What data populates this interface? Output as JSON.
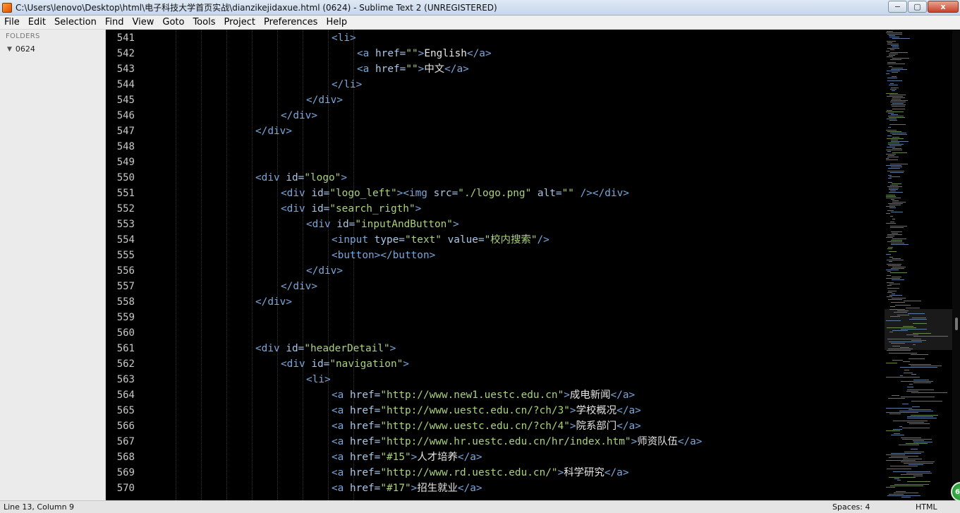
{
  "window": {
    "title": "C:\\Users\\lenovo\\Desktop\\html\\电子科技大学首页实战\\dianzikejidaxue.html (0624) - Sublime Text 2 (UNREGISTERED)",
    "minimize": "−",
    "maximize": "▢",
    "close": "x"
  },
  "menu": [
    "File",
    "Edit",
    "Selection",
    "Find",
    "View",
    "Goto",
    "Tools",
    "Project",
    "Preferences",
    "Help"
  ],
  "sidebar": {
    "heading": "FOLDERS",
    "folder": "0624",
    "arrow": "▼"
  },
  "editor": {
    "lines": [
      {
        "n": "541",
        "indent": 7,
        "tokens": [
          [
            "tag",
            "<li>"
          ]
        ]
      },
      {
        "n": "542",
        "indent": 8,
        "tokens": [
          [
            "tag",
            "<a "
          ],
          [
            "attr",
            "href="
          ],
          [
            "str",
            "\"\""
          ],
          [
            "tag",
            ">"
          ],
          [
            "txt",
            "English"
          ],
          [
            "tag",
            "</a>"
          ]
        ]
      },
      {
        "n": "543",
        "indent": 8,
        "tokens": [
          [
            "tag",
            "<a "
          ],
          [
            "attr",
            "href="
          ],
          [
            "str",
            "\"\""
          ],
          [
            "tag",
            ">"
          ],
          [
            "txt",
            "中文"
          ],
          [
            "tag",
            "</a>"
          ]
        ]
      },
      {
        "n": "544",
        "indent": 7,
        "tokens": [
          [
            "tag",
            "</li>"
          ]
        ]
      },
      {
        "n": "545",
        "indent": 6,
        "tokens": [
          [
            "tag",
            "</div>"
          ]
        ]
      },
      {
        "n": "546",
        "indent": 5,
        "tokens": [
          [
            "tag",
            "</div>"
          ]
        ]
      },
      {
        "n": "547",
        "indent": 4,
        "tokens": [
          [
            "tag",
            "</div>"
          ]
        ]
      },
      {
        "n": "548",
        "indent": 0,
        "tokens": []
      },
      {
        "n": "549",
        "indent": 0,
        "tokens": []
      },
      {
        "n": "550",
        "indent": 4,
        "tokens": [
          [
            "tag",
            "<div "
          ],
          [
            "attr",
            "id="
          ],
          [
            "str",
            "\"logo\""
          ],
          [
            "tag",
            ">"
          ]
        ]
      },
      {
        "n": "551",
        "indent": 5,
        "tokens": [
          [
            "tag",
            "<div "
          ],
          [
            "attr",
            "id="
          ],
          [
            "str",
            "\"logo_left\""
          ],
          [
            "tag",
            ">"
          ],
          [
            "tag",
            "<img "
          ],
          [
            "attr",
            "src="
          ],
          [
            "str",
            "\"./logo.png\""
          ],
          [
            "attr",
            " alt="
          ],
          [
            "str",
            "\"\""
          ],
          [
            "tag",
            " />"
          ],
          [
            "tag",
            "</div>"
          ]
        ]
      },
      {
        "n": "552",
        "indent": 5,
        "tokens": [
          [
            "tag",
            "<div "
          ],
          [
            "attr",
            "id="
          ],
          [
            "str",
            "\"search_rigth\""
          ],
          [
            "tag",
            ">"
          ]
        ]
      },
      {
        "n": "553",
        "indent": 6,
        "tokens": [
          [
            "tag",
            "<div "
          ],
          [
            "attr",
            "id="
          ],
          [
            "str",
            "\"inputAndButton\""
          ],
          [
            "tag",
            ">"
          ]
        ]
      },
      {
        "n": "554",
        "indent": 7,
        "tokens": [
          [
            "tag",
            "<input "
          ],
          [
            "attr",
            "type="
          ],
          [
            "str",
            "\"text\""
          ],
          [
            "attr",
            " value="
          ],
          [
            "str",
            "\"校内搜索\""
          ],
          [
            "tag",
            "/>"
          ]
        ]
      },
      {
        "n": "555",
        "indent": 7,
        "tokens": [
          [
            "tag",
            "<button>"
          ],
          [
            "tag",
            "</button>"
          ]
        ]
      },
      {
        "n": "556",
        "indent": 6,
        "tokens": [
          [
            "tag",
            "</div>"
          ]
        ]
      },
      {
        "n": "557",
        "indent": 5,
        "tokens": [
          [
            "tag",
            "</div>"
          ]
        ]
      },
      {
        "n": "558",
        "indent": 4,
        "tokens": [
          [
            "tag",
            "</div>"
          ]
        ]
      },
      {
        "n": "559",
        "indent": 0,
        "tokens": []
      },
      {
        "n": "560",
        "indent": 0,
        "tokens": []
      },
      {
        "n": "561",
        "indent": 4,
        "tokens": [
          [
            "tag",
            "<div "
          ],
          [
            "attr",
            "id="
          ],
          [
            "str",
            "\"headerDetail\""
          ],
          [
            "tag",
            ">"
          ]
        ]
      },
      {
        "n": "562",
        "indent": 5,
        "tokens": [
          [
            "tag",
            "<div "
          ],
          [
            "attr",
            "id="
          ],
          [
            "str",
            "\"navigation\""
          ],
          [
            "tag",
            ">"
          ]
        ]
      },
      {
        "n": "563",
        "indent": 6,
        "tokens": [
          [
            "tag",
            "<li>"
          ]
        ]
      },
      {
        "n": "564",
        "indent": 7,
        "tokens": [
          [
            "tag",
            "<a "
          ],
          [
            "attr",
            "href="
          ],
          [
            "str",
            "\"http://www.new1.uestc.edu.cn\""
          ],
          [
            "tag",
            ">"
          ],
          [
            "txt",
            "成电新闻"
          ],
          [
            "tag",
            "</a>"
          ]
        ]
      },
      {
        "n": "565",
        "indent": 7,
        "tokens": [
          [
            "tag",
            "<a "
          ],
          [
            "attr",
            "href="
          ],
          [
            "str",
            "\"http://www.uestc.edu.cn/?ch/3\""
          ],
          [
            "tag",
            ">"
          ],
          [
            "txt",
            "学校概况"
          ],
          [
            "tag",
            "</a>"
          ]
        ]
      },
      {
        "n": "566",
        "indent": 7,
        "tokens": [
          [
            "tag",
            "<a "
          ],
          [
            "attr",
            "href="
          ],
          [
            "str",
            "\"http://www.uestc.edu.cn/?ch/4\""
          ],
          [
            "tag",
            ">"
          ],
          [
            "txt",
            "院系部门"
          ],
          [
            "tag",
            "</a>"
          ]
        ]
      },
      {
        "n": "567",
        "indent": 7,
        "tokens": [
          [
            "tag",
            "<a "
          ],
          [
            "attr",
            "href="
          ],
          [
            "str",
            "\"http://www.hr.uestc.edu.cn/hr/index.htm\""
          ],
          [
            "tag",
            ">"
          ],
          [
            "txt",
            "师资队伍"
          ],
          [
            "tag",
            "</a>"
          ]
        ]
      },
      {
        "n": "568",
        "indent": 7,
        "tokens": [
          [
            "tag",
            "<a "
          ],
          [
            "attr",
            "href="
          ],
          [
            "str",
            "\"#15\""
          ],
          [
            "tag",
            ">"
          ],
          [
            "txt",
            "人才培养"
          ],
          [
            "tag",
            "</a>"
          ]
        ]
      },
      {
        "n": "569",
        "indent": 7,
        "tokens": [
          [
            "tag",
            "<a "
          ],
          [
            "attr",
            "href="
          ],
          [
            "str",
            "\"http://www.rd.uestc.edu.cn/\""
          ],
          [
            "tag",
            ">"
          ],
          [
            "txt",
            "科学研究"
          ],
          [
            "tag",
            "</a>"
          ]
        ]
      },
      {
        "n": "570",
        "indent": 7,
        "tokens": [
          [
            "tag",
            "<a "
          ],
          [
            "attr",
            "href="
          ],
          [
            "str",
            "\"#17\""
          ],
          [
            "tag",
            ">"
          ],
          [
            "txt",
            "招生就业"
          ],
          [
            "tag",
            "</a>"
          ]
        ]
      }
    ]
  },
  "status": {
    "position": "Line 13, Column 9",
    "spaces": "Spaces: 4",
    "syntax": "HTML",
    "badge": "6"
  }
}
